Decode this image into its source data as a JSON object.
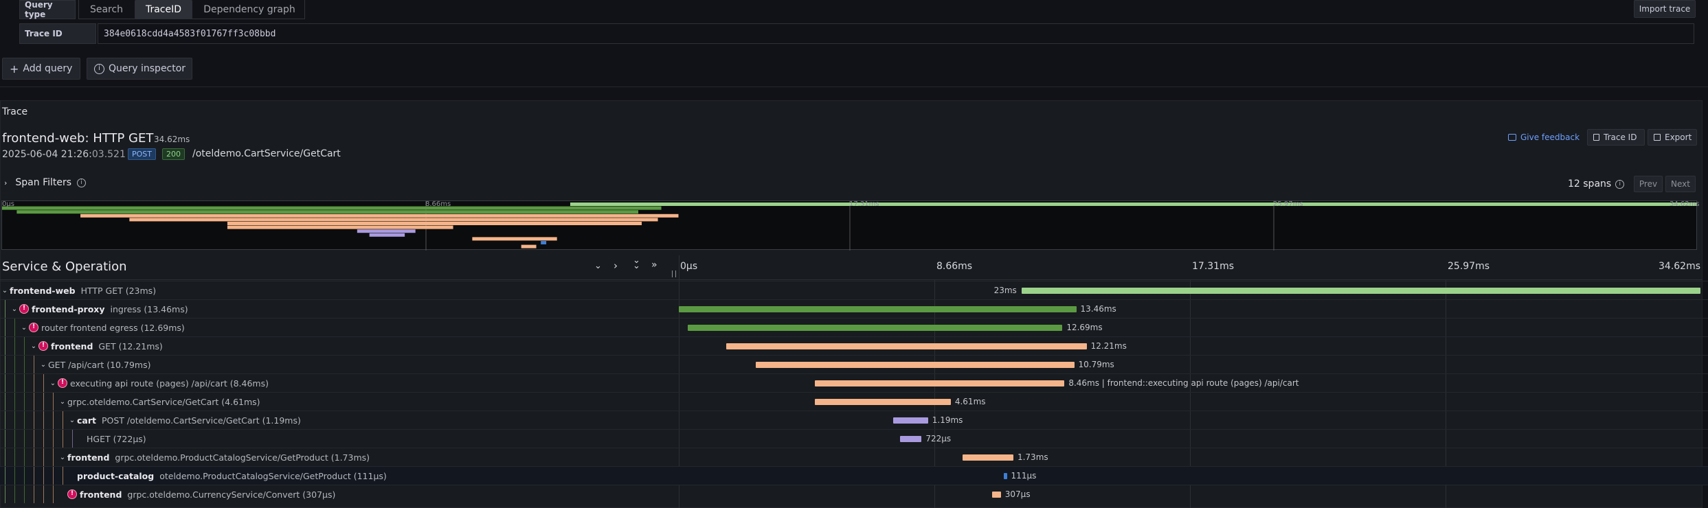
{
  "query": {
    "type_label": "Query type",
    "tabs": [
      "Search",
      "TraceID",
      "Dependency graph"
    ],
    "active_tab": "TraceID",
    "import_label": "Import trace",
    "trace_id_label": "Trace ID",
    "trace_id_value": "384e0618cdd4a4583f01767ff3c08bbd",
    "add_query_label": "Add query",
    "inspector_label": "Query inspector"
  },
  "trace": {
    "section_label": "Trace",
    "title": "frontend-web: HTTP GET",
    "duration": "34.62ms",
    "timestamp_main": "2025-06-04 21:26:",
    "timestamp_sec": "03.521",
    "method": "POST",
    "status": "200",
    "url": "/oteldemo.CartService/GetCart",
    "feedback_label": "Give feedback",
    "trace_id_btn": "Trace ID",
    "export_btn": "Export",
    "span_filters_label": "Span Filters",
    "span_count": "12 spans",
    "prev_label": "Prev",
    "next_label": "Next"
  },
  "minimap": {
    "ticks": [
      "0μs",
      "8.66ms",
      "17.31ms",
      "25.97ms",
      "34.62ms"
    ]
  },
  "timeline": {
    "header_label": "Service & Operation",
    "ticks": [
      "0μs",
      "8.66ms",
      "17.31ms",
      "25.97ms",
      "34.62ms"
    ],
    "total_ms": 34.62
  },
  "colors": {
    "web": "#9bd38b",
    "proxy": "#5b9a42",
    "frontend": "#f5b489",
    "cart": "#a99ae0",
    "catalog": "#3d7fd6",
    "error": "#d10e5c"
  },
  "spans": [
    {
      "service": "frontend-web",
      "op": "HTTP GET (23ms)",
      "depth": 0,
      "chev": true,
      "err": false,
      "start": 11.6,
      "dur": 23,
      "color": "web",
      "label": "23ms",
      "label_left": true
    },
    {
      "service": "frontend-proxy",
      "op": "ingress (13.46ms)",
      "depth": 1,
      "chev": true,
      "err": true,
      "start": 0,
      "dur": 13.46,
      "color": "proxy",
      "label": "13.46ms"
    },
    {
      "service": "",
      "op": "router frontend egress (12.69ms)",
      "depth": 2,
      "chev": true,
      "err": true,
      "start": 0.3,
      "dur": 12.69,
      "color": "proxy",
      "label": "12.69ms"
    },
    {
      "service": "frontend",
      "op": "GET (12.21ms)",
      "depth": 3,
      "chev": true,
      "err": true,
      "start": 1.6,
      "dur": 12.21,
      "color": "frontend",
      "label": "12.21ms"
    },
    {
      "service": "",
      "op": "GET /api/cart (10.79ms)",
      "depth": 4,
      "chev": true,
      "err": false,
      "start": 2.6,
      "dur": 10.79,
      "color": "frontend",
      "label": "10.79ms"
    },
    {
      "service": "",
      "op": "executing api route (pages) /api/cart (8.46ms)",
      "depth": 5,
      "chev": true,
      "err": true,
      "start": 4.6,
      "dur": 8.46,
      "color": "frontend",
      "label": "8.46ms | frontend::executing api route (pages) /api/cart"
    },
    {
      "service": "",
      "op": "grpc.oteldemo.CartService/GetCart (4.61ms)",
      "depth": 6,
      "chev": true,
      "err": false,
      "start": 4.6,
      "dur": 4.61,
      "color": "frontend",
      "label": "4.61ms"
    },
    {
      "service": "cart",
      "op": "POST /oteldemo.CartService/GetCart (1.19ms)",
      "depth": 7,
      "chev": true,
      "err": false,
      "start": 7.25,
      "dur": 1.19,
      "color": "cart",
      "label": "1.19ms"
    },
    {
      "service": "",
      "op": "HGET (722μs)",
      "depth": 8,
      "chev": false,
      "err": false,
      "start": 7.5,
      "dur": 0.722,
      "color": "cart",
      "label": "722μs"
    },
    {
      "service": "frontend",
      "op": "grpc.oteldemo.ProductCatalogService/GetProduct (1.73ms)",
      "depth": 6,
      "chev": true,
      "err": false,
      "start": 9.6,
      "dur": 1.73,
      "color": "frontend",
      "label": "1.73ms"
    },
    {
      "service": "product-catalog",
      "op": "oteldemo.ProductCatalogService/GetProduct (111μs)",
      "depth": 7,
      "chev": false,
      "err": false,
      "start": 11.0,
      "dur": 0.111,
      "color": "catalog",
      "label": "111μs"
    },
    {
      "service": "frontend",
      "op": "grpc.oteldemo.CurrencyService/Convert (307μs)",
      "depth": 6,
      "chev": false,
      "err": true,
      "start": 10.6,
      "dur": 0.307,
      "color": "frontend",
      "label": "307μs"
    }
  ]
}
